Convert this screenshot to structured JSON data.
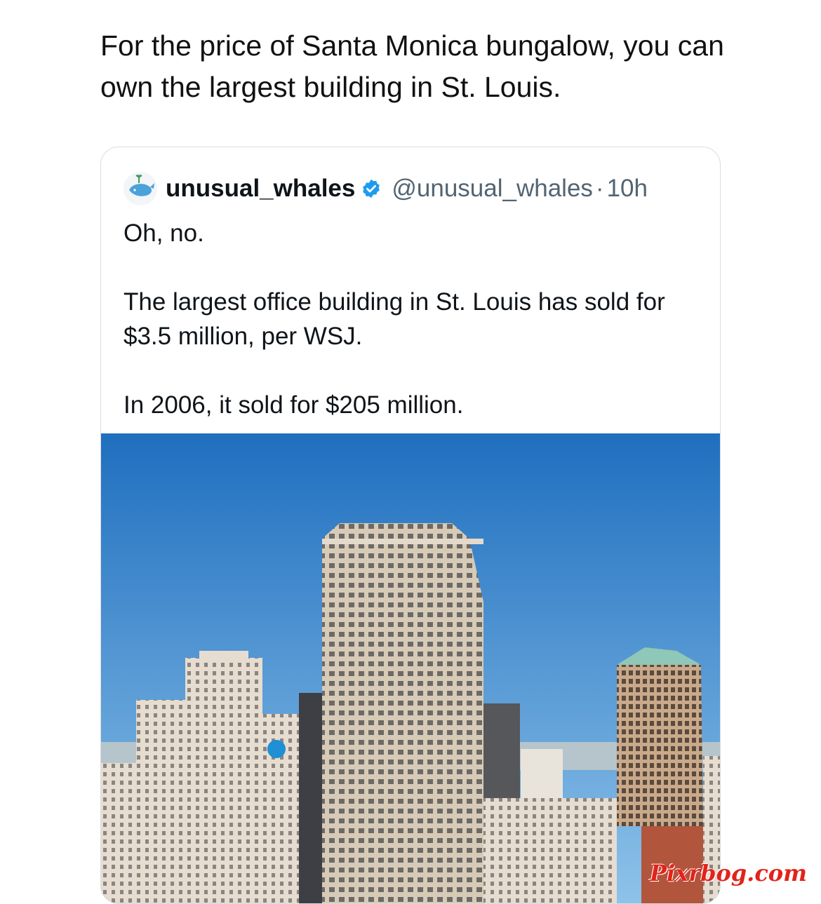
{
  "post": {
    "text": "For the price of Santa Monica bungalow, you can own the largest building in St. Louis."
  },
  "quoted_tweet": {
    "avatar_icon": "whale-avatar-icon",
    "display_name": "unusual_whales",
    "verified_icon": "verified-badge-icon",
    "handle": "@unusual_whales",
    "separator": "·",
    "time": "10h",
    "lines": [
      "Oh, no.",
      "The largest office building in St. Louis has sold for $3.5 million, per WSJ.",
      "In 2006, it sold for $205 million."
    ],
    "image_description_colors": {
      "sky": "#2f7fc8",
      "building": "#d8c9b6",
      "accent": "#1d9bf0"
    }
  },
  "watermark": "Pixrbog.com"
}
